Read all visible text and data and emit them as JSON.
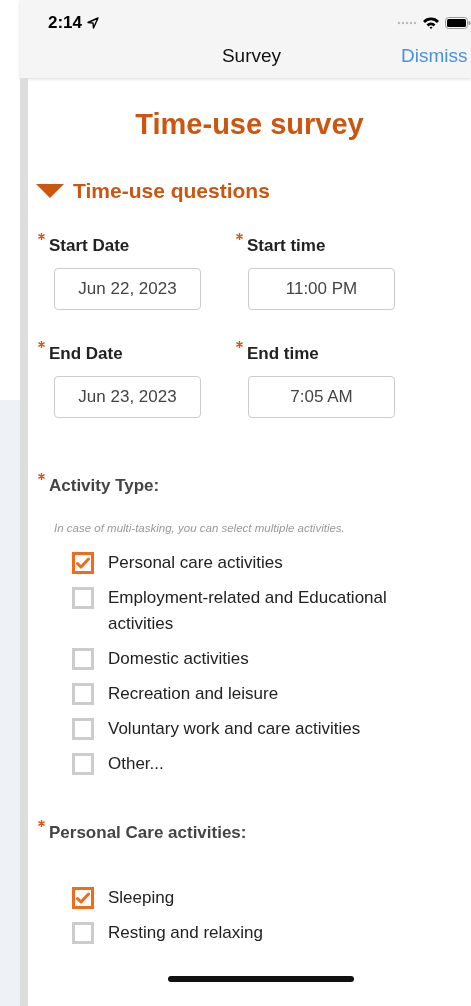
{
  "status_bar": {
    "time": "2:14"
  },
  "nav": {
    "title": "Survey",
    "action": "Dismiss"
  },
  "survey_title": "Time-use survey",
  "section": {
    "title": "Time-use questions",
    "expanded": true
  },
  "fields": [
    {
      "label": "Start Date",
      "value": "Jun 22, 2023",
      "required": true
    },
    {
      "label": "Start time",
      "value": "11:00 PM",
      "required": true
    },
    {
      "label": "End Date",
      "value": "Jun 23, 2023",
      "required": true
    },
    {
      "label": "End time",
      "value": "7:05 AM",
      "required": true
    }
  ],
  "questions": [
    {
      "label": "Activity Type:",
      "required": true,
      "hint": "In case of multi-tasking, you can select multiple activities.",
      "options": [
        {
          "label": "Personal care activities",
          "checked": true
        },
        {
          "label": "Employment-related and Educational activities",
          "checked": false
        },
        {
          "label": "Domestic activities",
          "checked": false
        },
        {
          "label": "Recreation and leisure",
          "checked": false
        },
        {
          "label": "Voluntary work and care activities",
          "checked": false
        },
        {
          "label": "Other...",
          "checked": false
        }
      ]
    },
    {
      "label": "Personal Care activities:",
      "required": true,
      "options": [
        {
          "label": "Sleeping",
          "checked": true
        },
        {
          "label": "Resting and relaxing",
          "checked": false
        }
      ]
    }
  ]
}
